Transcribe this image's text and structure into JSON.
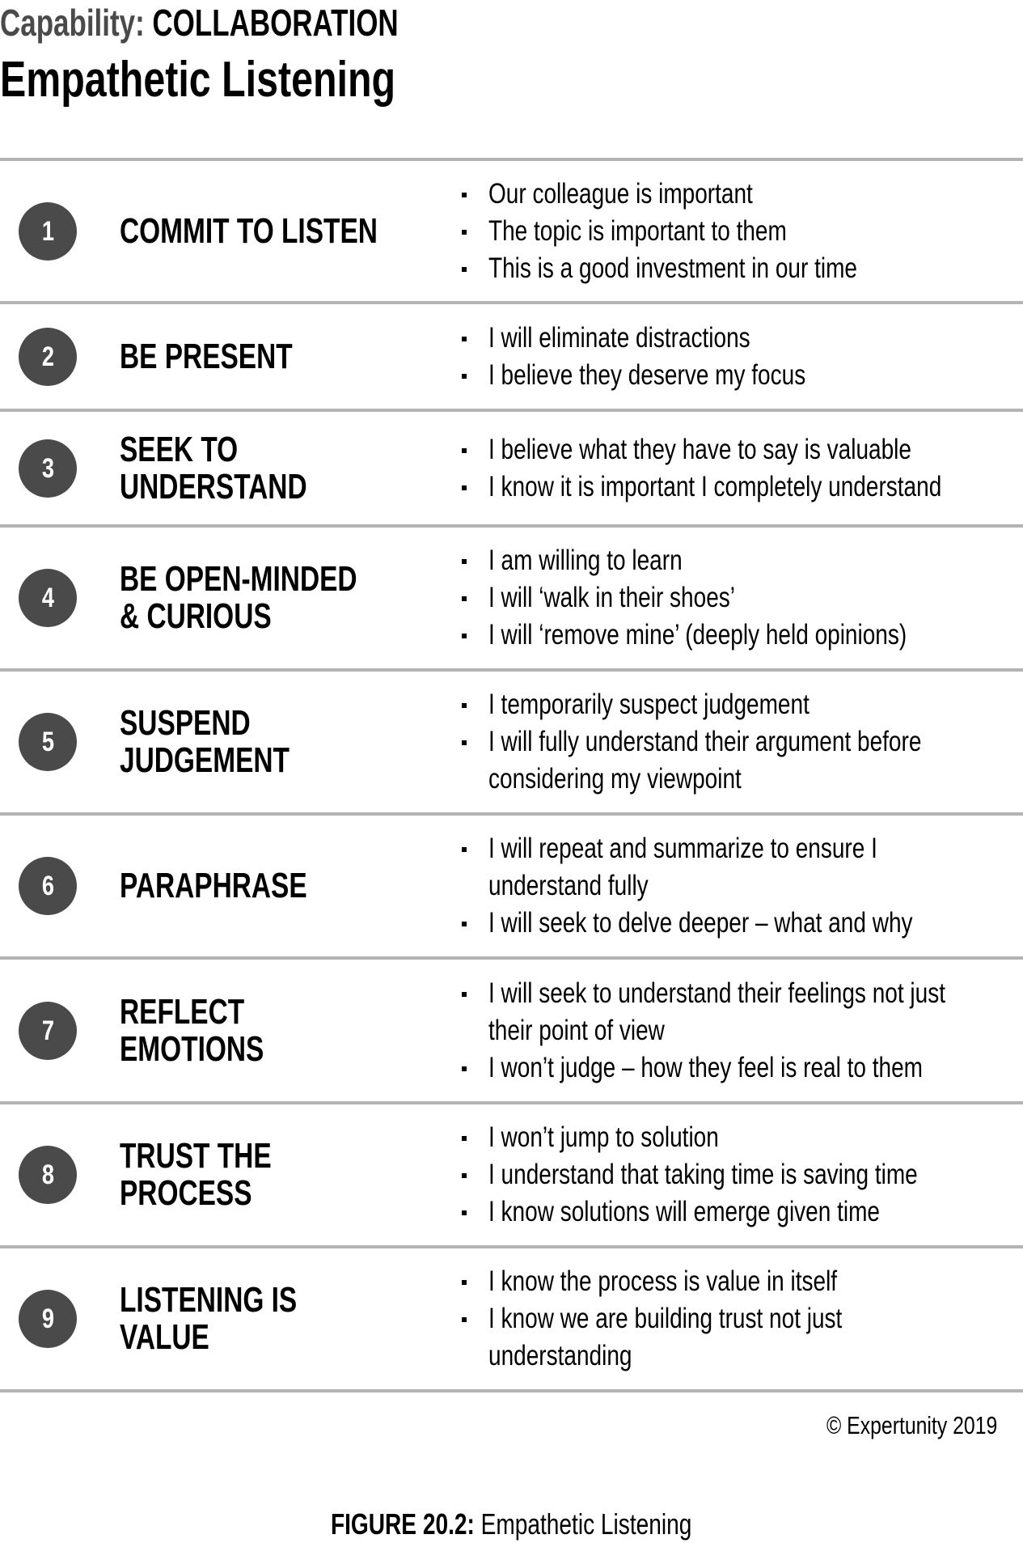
{
  "header": {
    "capability_label": "Capability:",
    "capability_value": "COLLABORATION",
    "title": "Empathetic Listening"
  },
  "colors": {
    "circle": "#4a4a4a",
    "divider": "#b3b3b3",
    "capability_label": "#4a4a4a",
    "text": "#000000"
  },
  "rows": [
    {
      "number": "1",
      "title_lines": [
        "COMMIT TO LISTEN"
      ],
      "bullets": [
        [
          "Our colleague is important"
        ],
        [
          "The topic is important to them"
        ],
        [
          "This is a good investment in our time"
        ]
      ]
    },
    {
      "number": "2",
      "title_lines": [
        "BE PRESENT"
      ],
      "bullets": [
        [
          "I will eliminate distractions"
        ],
        [
          "I believe they deserve my focus"
        ]
      ]
    },
    {
      "number": "3",
      "title_lines": [
        "SEEK TO",
        "UNDERSTAND"
      ],
      "bullets": [
        [
          "I believe what they have to say is valuable"
        ],
        [
          "I know it is important I completely understand"
        ]
      ]
    },
    {
      "number": "4",
      "title_lines": [
        "BE OPEN-MINDED",
        "& CURIOUS"
      ],
      "bullets": [
        [
          "I am willing to learn"
        ],
        [
          "I will ‘walk in their shoes’"
        ],
        [
          "I will ‘remove mine’ (deeply held opinions)"
        ]
      ]
    },
    {
      "number": "5",
      "title_lines": [
        "SUSPEND",
        "JUDGEMENT"
      ],
      "bullets": [
        [
          "I temporarily suspect judgement"
        ],
        [
          "I will fully understand their argument before",
          "considering my viewpoint"
        ]
      ]
    },
    {
      "number": "6",
      "title_lines": [
        "PARAPHRASE"
      ],
      "bullets": [
        [
          "I will repeat and summarize to ensure I",
          "understand fully"
        ],
        [
          "I will seek to delve deeper – what and why"
        ]
      ]
    },
    {
      "number": "7",
      "title_lines": [
        "REFLECT",
        "EMOTIONS"
      ],
      "bullets": [
        [
          "I will seek to understand their feelings not just",
          "their point of view"
        ],
        [
          "I won’t judge – how they feel is real to them"
        ]
      ]
    },
    {
      "number": "8",
      "title_lines": [
        "TRUST THE",
        "PROCESS"
      ],
      "bullets": [
        [
          "I won’t jump to solution"
        ],
        [
          "I understand that taking time is saving time"
        ],
        [
          "I know solutions will emerge given time"
        ]
      ]
    },
    {
      "number": "9",
      "title_lines": [
        "LISTENING IS",
        "VALUE"
      ],
      "bullets": [
        [
          "I know the process is value in itself"
        ],
        [
          "I know we are building trust not just",
          "understanding"
        ]
      ]
    }
  ],
  "copyright": "© Expertunity 2019",
  "caption": {
    "label": "FIGURE 20.2:",
    "text": "Empathetic Listening"
  }
}
